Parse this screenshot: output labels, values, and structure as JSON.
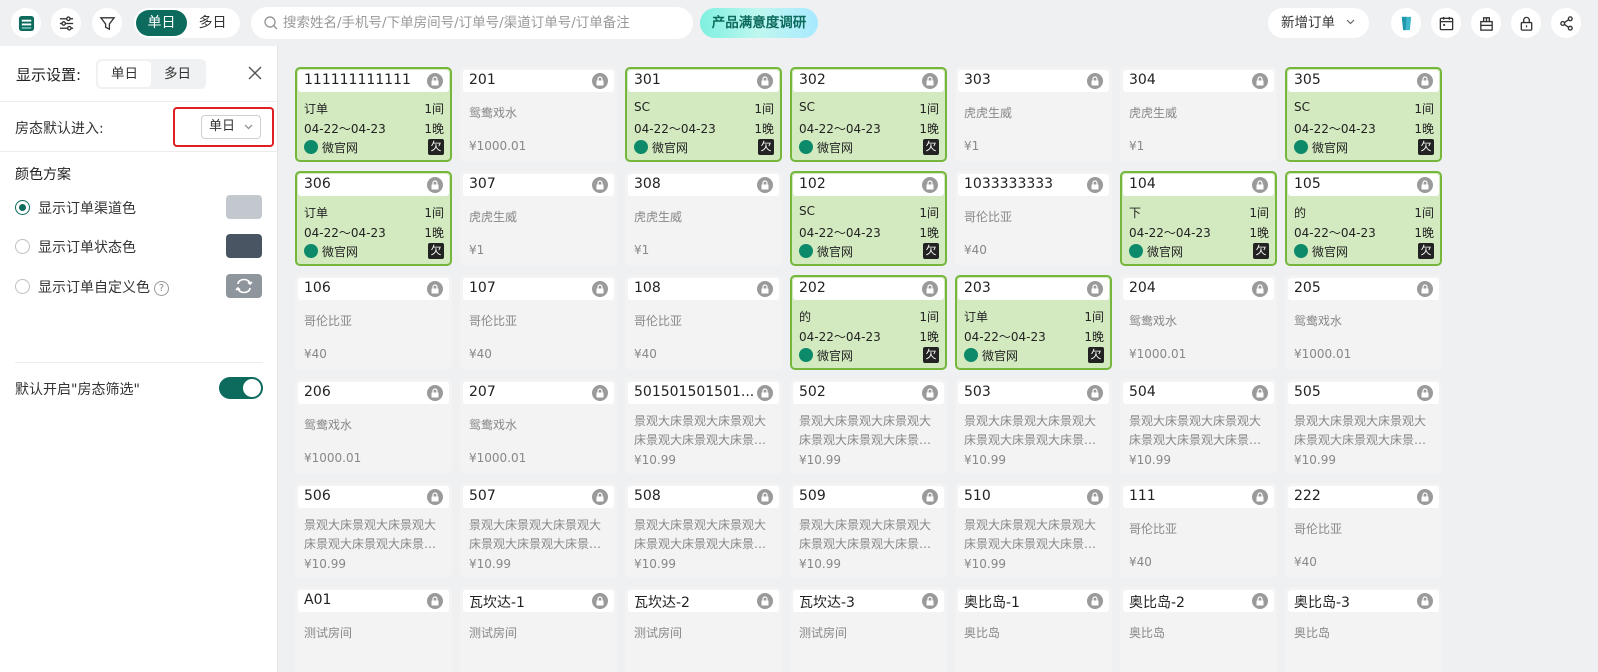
{
  "topbar": {
    "icons": [
      "app-logo-icon",
      "sliders-icon",
      "filter-icon"
    ],
    "day_toggle": {
      "single": "单日",
      "multi": "多日",
      "active": "single"
    },
    "search_placeholder": "搜索姓名/手机号/下单房间号/订单号/渠道订单号/订单备注",
    "survey_label": "产品满意度调研",
    "new_order_label": "新增订单",
    "right_icons": [
      "cup-icon",
      "calendar-icon",
      "building-icon",
      "lock-icon",
      "share-icon"
    ]
  },
  "panel": {
    "title": "显示设置:",
    "view_tabs": {
      "single": "单日",
      "multi": "多日",
      "active": "single"
    },
    "default_enter_label": "房态默认进入:",
    "default_enter_value": "单日",
    "color_scheme_title": "颜色方案",
    "color_options": [
      {
        "label": "显示订单渠道色",
        "checked": true,
        "swatch": "#c3c8ce"
      },
      {
        "label": "显示订单状态色",
        "checked": false,
        "swatch": "#4a5563"
      },
      {
        "label": "显示订单自定义色",
        "checked": false,
        "swatch": "#8f959d",
        "help": "?"
      }
    ],
    "filter_toggle_label": "默认开启\"房态筛选\"",
    "filter_toggle_on": true
  },
  "colors": {
    "accent": "#0d6b5e",
    "occupied_bg": "#d3eac0",
    "occupied_border": "#76b63c",
    "highlight": "#e02020"
  },
  "rooms": [
    {
      "room": "111111111111",
      "occupied": true,
      "name": "订单",
      "rooms": "1间",
      "dates": "04-22～04-23",
      "nights": "1晚",
      "channel": "微官网",
      "debt": "欠"
    },
    {
      "room": "201",
      "occupied": false,
      "type": "鸳鸯戏水",
      "price": "¥1000.01"
    },
    {
      "room": "301",
      "occupied": true,
      "name": "SC",
      "rooms": "1间",
      "dates": "04-22～04-23",
      "nights": "1晚",
      "channel": "微官网",
      "debt": "欠"
    },
    {
      "room": "302",
      "occupied": true,
      "name": "SC",
      "rooms": "1间",
      "dates": "04-22～04-23",
      "nights": "1晚",
      "channel": "微官网",
      "debt": "欠"
    },
    {
      "room": "303",
      "occupied": false,
      "type": "虎虎生威",
      "price": "¥1"
    },
    {
      "room": "304",
      "occupied": false,
      "type": "虎虎生威",
      "price": "¥1"
    },
    {
      "room": "305",
      "occupied": true,
      "name": "SC",
      "rooms": "1间",
      "dates": "04-22～04-23",
      "nights": "1晚",
      "channel": "微官网",
      "debt": "欠"
    },
    {
      "room": "306",
      "occupied": true,
      "name": "订单",
      "rooms": "1间",
      "dates": "04-22～04-23",
      "nights": "1晚",
      "channel": "微官网",
      "debt": "欠"
    },
    {
      "room": "307",
      "occupied": false,
      "type": "虎虎生威",
      "price": "¥1"
    },
    {
      "room": "308",
      "occupied": false,
      "type": "虎虎生威",
      "price": "¥1"
    },
    {
      "room": "102",
      "occupied": true,
      "name": "SC",
      "rooms": "1间",
      "dates": "04-22～04-23",
      "nights": "1晚",
      "channel": "微官网",
      "debt": "欠"
    },
    {
      "room": "1033333333",
      "occupied": false,
      "type": "哥伦比亚",
      "price": "¥40"
    },
    {
      "room": "104",
      "occupied": true,
      "name": "下",
      "rooms": "1间",
      "dates": "04-22～04-23",
      "nights": "1晚",
      "channel": "微官网",
      "debt": "欠"
    },
    {
      "room": "105",
      "occupied": true,
      "name": "的",
      "rooms": "1间",
      "dates": "04-22～04-23",
      "nights": "1晚",
      "channel": "微官网",
      "debt": "欠"
    },
    {
      "room": "106",
      "occupied": false,
      "type": "哥伦比亚",
      "price": "¥40"
    },
    {
      "room": "107",
      "occupied": false,
      "type": "哥伦比亚",
      "price": "¥40"
    },
    {
      "room": "108",
      "occupied": false,
      "type": "哥伦比亚",
      "price": "¥40"
    },
    {
      "room": "202",
      "occupied": true,
      "name": "的",
      "rooms": "1间",
      "dates": "04-22～04-23",
      "nights": "1晚",
      "channel": "微官网",
      "debt": "欠"
    },
    {
      "room": "203",
      "occupied": true,
      "name": "订单",
      "rooms": "1间",
      "dates": "04-22～04-23",
      "nights": "1晚",
      "channel": "微官网",
      "debt": "欠"
    },
    {
      "room": "204",
      "occupied": false,
      "type": "鸳鸯戏水",
      "price": "¥1000.01"
    },
    {
      "room": "205",
      "occupied": false,
      "type": "鸳鸯戏水",
      "price": "¥1000.01"
    },
    {
      "room": "206",
      "occupied": false,
      "type": "鸳鸯戏水",
      "price": "¥1000.01"
    },
    {
      "room": "207",
      "occupied": false,
      "type": "鸳鸯戏水",
      "price": "¥1000.01"
    },
    {
      "room": "501501501501...",
      "occupied": false,
      "long": true,
      "type": "景观大床景观大床景观大床景观大床景观大床景观大床",
      "price": "¥10.99"
    },
    {
      "room": "502",
      "occupied": false,
      "long": true,
      "type": "景观大床景观大床景观大床景观大床景观大床景观大床",
      "price": "¥10.99"
    },
    {
      "room": "503",
      "occupied": false,
      "long": true,
      "type": "景观大床景观大床景观大床景观大床景观大床景观大床",
      "price": "¥10.99"
    },
    {
      "room": "504",
      "occupied": false,
      "long": true,
      "type": "景观大床景观大床景观大床景观大床景观大床景观大床",
      "price": "¥10.99"
    },
    {
      "room": "505",
      "occupied": false,
      "long": true,
      "type": "景观大床景观大床景观大床景观大床景观大床景观大床",
      "price": "¥10.99"
    },
    {
      "room": "506",
      "occupied": false,
      "long": true,
      "type": "景观大床景观大床景观大床景观大床景观大床景观大床",
      "price": "¥10.99"
    },
    {
      "room": "507",
      "occupied": false,
      "long": true,
      "type": "景观大床景观大床景观大床景观大床景观大床景观大床",
      "price": "¥10.99"
    },
    {
      "room": "508",
      "occupied": false,
      "long": true,
      "type": "景观大床景观大床景观大床景观大床景观大床景观大床",
      "price": "¥10.99"
    },
    {
      "room": "509",
      "occupied": false,
      "long": true,
      "type": "景观大床景观大床景观大床景观大床景观大床景观大床",
      "price": "¥10.99"
    },
    {
      "room": "510",
      "occupied": false,
      "long": true,
      "type": "景观大床景观大床景观大床景观大床景观大床景观大床",
      "price": "¥10.99"
    },
    {
      "room": "111",
      "occupied": false,
      "type": "哥伦比亚",
      "price": "¥40"
    },
    {
      "room": "222",
      "occupied": false,
      "type": "哥伦比亚",
      "price": "¥40"
    },
    {
      "room": "A01",
      "occupied": false,
      "type": "测试房间",
      "price": ""
    },
    {
      "room": "瓦坎达-1",
      "occupied": false,
      "type": "测试房间",
      "price": ""
    },
    {
      "room": "瓦坎达-2",
      "occupied": false,
      "type": "测试房间",
      "price": ""
    },
    {
      "room": "瓦坎达-3",
      "occupied": false,
      "type": "测试房间",
      "price": ""
    },
    {
      "room": "奥比岛-1",
      "occupied": false,
      "type": "奥比岛",
      "price": ""
    },
    {
      "room": "奥比岛-2",
      "occupied": false,
      "type": "奥比岛",
      "price": ""
    },
    {
      "room": "奥比岛-3",
      "occupied": false,
      "type": "奥比岛",
      "price": ""
    }
  ]
}
